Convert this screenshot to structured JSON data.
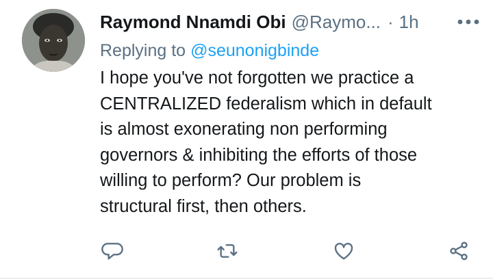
{
  "tweet": {
    "author_name": "Raymond Nnamdi Obi",
    "author_handle": "@Raymo...",
    "separator": "·",
    "time": "1h",
    "reply_prefix": "Replying to",
    "reply_to": "@seunonigbinde",
    "text": "I hope you've not forgotten we practice a\nCENTRALIZED federalism which in default\nis almost exonerating non performing\ngovernors & inhibiting the efforts of those\nwilling to perform? Our problem is\nstructural first, then others."
  },
  "icons": {
    "more": "more-horizontal-icon",
    "reply": "reply-bubble-icon",
    "retweet": "retweet-icon",
    "like": "heart-icon",
    "share": "share-icon"
  },
  "colors": {
    "text_primary": "#14171a",
    "text_secondary": "#5b7083",
    "link": "#1da1f2",
    "icon": "#5b7083"
  }
}
